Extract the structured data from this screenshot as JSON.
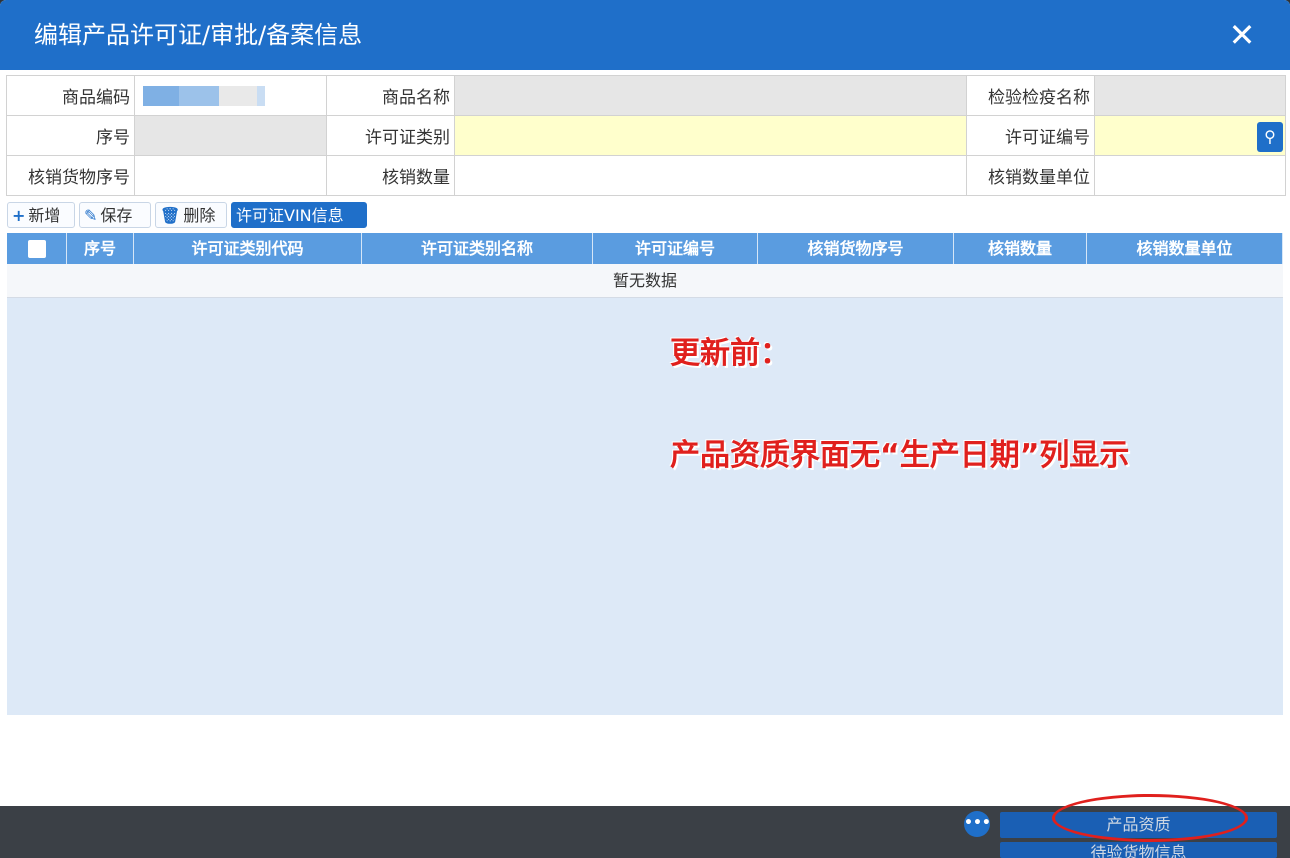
{
  "dialog": {
    "title": "编辑产品许可证/审批/备案信息",
    "close_label": "✕"
  },
  "form": {
    "row1": {
      "label1": "商品编码",
      "label2": "商品名称",
      "label3": "检验检疫名称"
    },
    "row2": {
      "label1": "序号",
      "label2": "许可证类别",
      "label3": "许可证编号"
    },
    "row3": {
      "label1": "核销货物序号",
      "label2": "核销数量",
      "label3": "核销数量单位"
    },
    "search_icon": "search-icon"
  },
  "toolbar": {
    "add_label": "新增",
    "save_label": "保存",
    "delete_label": "删除",
    "vin_label": "许可证VIN信息"
  },
  "grid": {
    "columns": [
      "序号",
      "许可证类别代码",
      "许可证类别名称",
      "许可证编号",
      "核销货物序号",
      "核销数量",
      "核销数量单位"
    ],
    "empty_text": "暂无数据"
  },
  "annotations": {
    "line1": "更新前：",
    "line2": "产品资质界面无“生产日期”列显示"
  },
  "footer": {
    "button1": "产品资质",
    "button2": "待验货物信息",
    "more_label": "•••"
  }
}
